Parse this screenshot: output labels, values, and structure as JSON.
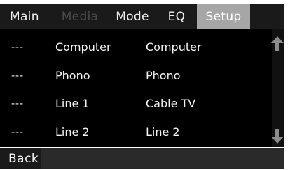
{
  "tabs": [
    {
      "label": "Main",
      "state": "normal"
    },
    {
      "label": "Media",
      "state": "disabled"
    },
    {
      "label": "Mode",
      "state": "normal"
    },
    {
      "label": "EQ",
      "state": "normal"
    },
    {
      "label": "Setup",
      "state": "active"
    }
  ],
  "rows": [
    {
      "col1": "---",
      "col2": "Computer",
      "col3": "Computer"
    },
    {
      "col1": "---",
      "col2": "Phono",
      "col3": "Phono"
    },
    {
      "col1": "---",
      "col2": "Line 1",
      "col3": "Cable TV"
    },
    {
      "col1": "---",
      "col2": "Line 2",
      "col3": "Line 2"
    }
  ],
  "scroll": {
    "up_icon": "arrow-up-icon",
    "down_icon": "arrow-down-icon"
  },
  "footer": {
    "back_label": "Back"
  },
  "colors": {
    "bar_background": "#1a1a1a",
    "content_background": "#000000",
    "active_tab": "#a6a6a6",
    "disabled_text": "#4a4a4a",
    "text": "#f2f2f2",
    "arrow": "#8c8c8c"
  }
}
